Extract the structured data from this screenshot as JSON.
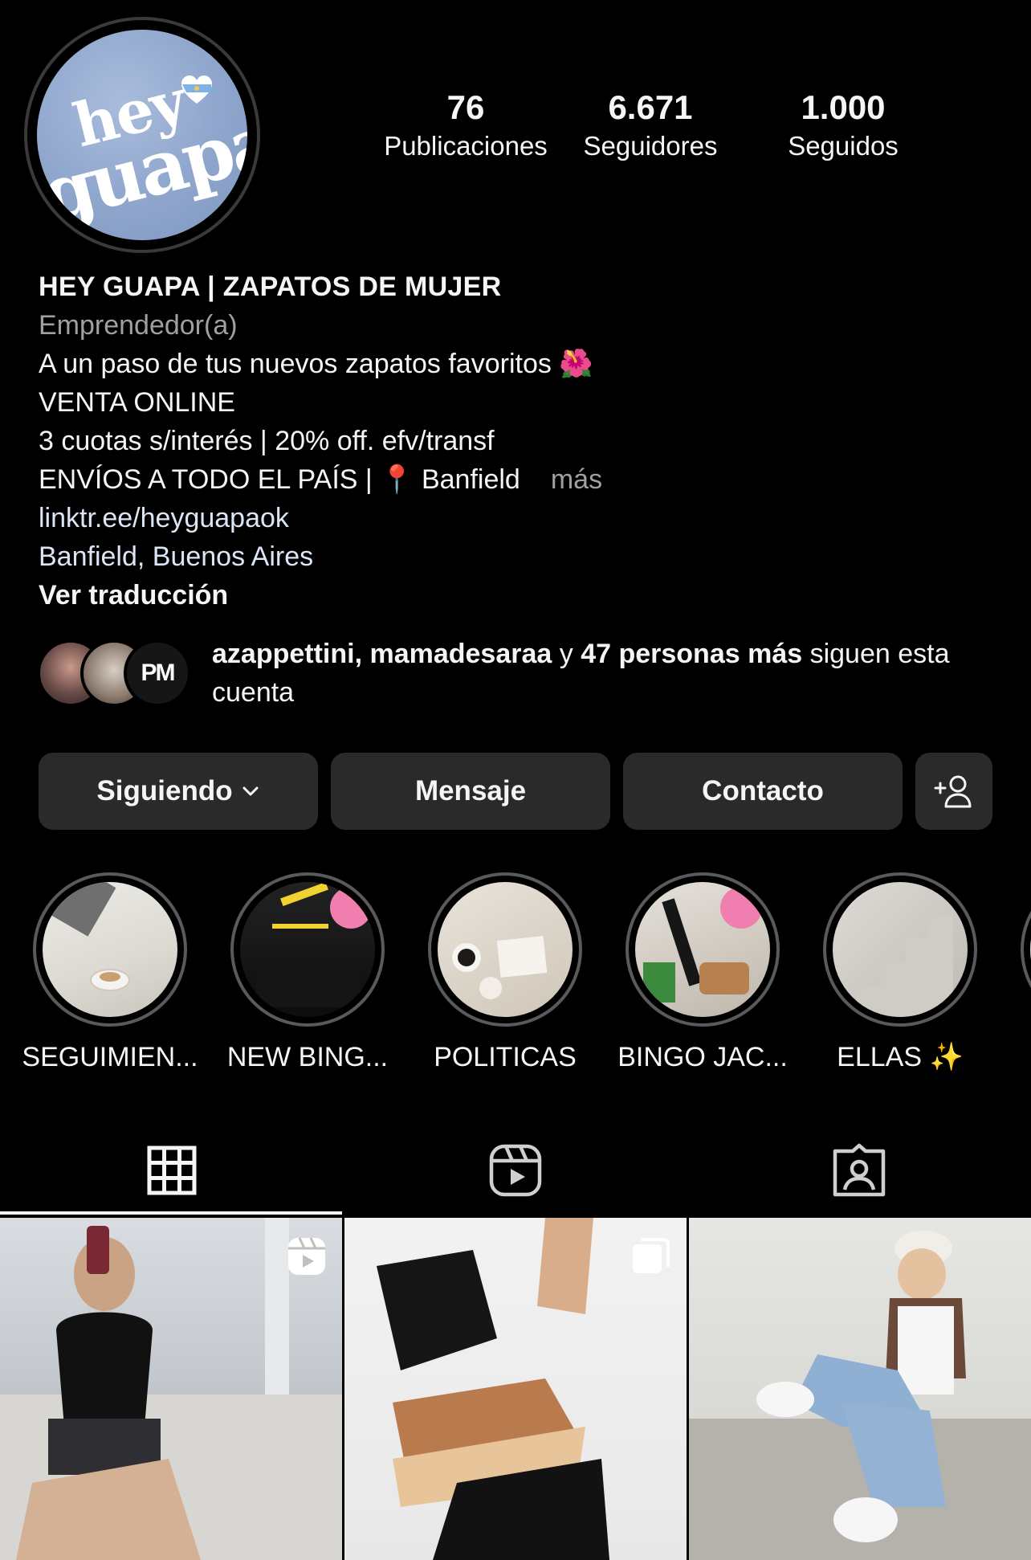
{
  "profile": {
    "avatar_text_top": "hey",
    "avatar_text_bottom": "guapa",
    "stats": [
      {
        "value": "76",
        "label": "Publicaciones"
      },
      {
        "value": "6.671",
        "label": "Seguidores"
      },
      {
        "value": "1.000",
        "label": "Seguidos"
      }
    ]
  },
  "bio": {
    "name": "HEY GUAPA | ZAPATOS DE MUJER",
    "category": "Emprendedor(a)",
    "line1": "A un paso de tus nuevos zapatos favoritos 🌺",
    "line2": "VENTA ONLINE",
    "line3": "3 cuotas s/interés | 20% off. efv/transf",
    "line4": "ENVÍOS A TODO EL PAÍS | 📍 Banfield",
    "more": "más",
    "link": "linktr.ee/heyguapaok",
    "location": "Banfield, Buenos Aires",
    "translate": "Ver traducción"
  },
  "followers": {
    "avatar3_text": "PM",
    "names": "azappettini, mamadesaraa",
    "joiner": "y",
    "others": "47 personas más",
    "suffix": "siguen esta cuenta"
  },
  "actions": {
    "following": "Siguiendo",
    "message": "Mensaje",
    "contact": "Contacto"
  },
  "highlights": [
    {
      "label": "SEGUIMIEN..."
    },
    {
      "label": "NEW BING..."
    },
    {
      "label": "POLITICAS"
    },
    {
      "label": "BINGO JAC..."
    },
    {
      "label": "ELLAS ✨"
    }
  ],
  "tabs": {
    "active": "grid",
    "icons": [
      "grid-icon",
      "reels-icon",
      "tagged-icon"
    ]
  },
  "posts": {
    "icons": [
      "reel-icon",
      "carousel-icon"
    ]
  }
}
